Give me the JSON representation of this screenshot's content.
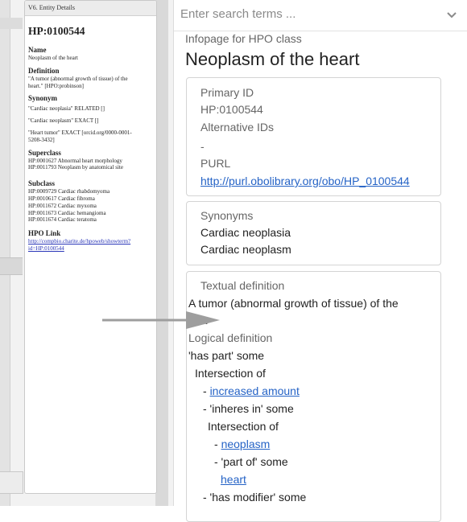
{
  "entity_panel": {
    "title": "V6. Entity Details",
    "id": "HP:0100544",
    "name_label": "Name",
    "name": "Neoplasm of the heart",
    "definition_label": "Definition",
    "definition_1": "\"A tumor (abnormal growth of tissue) of the",
    "definition_2": "heart.\" [HPO:probinson]",
    "synonym_label": "Synonym",
    "synonyms": [
      "\"Cardiac neoplasia\" RELATED []",
      "\"Cardiac neoplasm\" EXACT []",
      "\"Heart tumor\" EXACT [orcid.org/0000-0001-",
      "5208-3432]"
    ],
    "superclass_label": "Superclass",
    "superclasses": [
      "HP:0001627 Abnormal heart morphology",
      "HP:0011793 Neoplasm by anatomical site"
    ],
    "subclass_label": "Subclass",
    "subclasses": [
      "HP:0009729 Cardiac rhabdomyoma",
      "HP:0010617 Cardiac fibroma",
      "HP:0011672 Cardiac myxoma",
      "HP:0011673 Cardiac hemangioma",
      "HP:0011674 Cardiac teratoma"
    ],
    "hpo_link_label": "HPO Link",
    "hpo_link_1": "http://compbio.charite.de/hpoweb/showterm?",
    "hpo_link_2": "id=HP:0100544"
  },
  "search": {
    "placeholder": "Enter search terms ..."
  },
  "infopage": {
    "label": "Infopage for HPO class",
    "title": "Neoplasm of the heart"
  },
  "ids_card": {
    "primary_id_label": "Primary ID",
    "primary_id": "HP:0100544",
    "alt_ids_label": "Alternative IDs",
    "alt_ids_value": "-",
    "purl_label": "PURL",
    "purl": "http://purl.obolibrary.org/obo/HP_0100544"
  },
  "synonyms_card": {
    "label": "Synonyms",
    "items": [
      "Cardiac neoplasia",
      "Cardiac neoplasm"
    ]
  },
  "definition_card": {
    "textual_label": "Textual definition",
    "textual_line1": "A tumor (abnormal growth of tissue) of the",
    "textual_line2": "hea",
    "logical_label": "Logical definition",
    "lines": {
      "has_part": "'has part' some",
      "intersection1": "Intersection of",
      "increased_amount": "increased amount",
      "inheres_in": "- 'inheres in' some",
      "intersection2": "Intersection of",
      "neoplasm": "neoplasm",
      "part_of": "- 'part of' some",
      "heart": "heart",
      "has_modifier": "- 'has modifier' some",
      "dash": "- "
    }
  },
  "colors": {
    "link": "#2563c6",
    "arrow": "#9e9e9e"
  }
}
